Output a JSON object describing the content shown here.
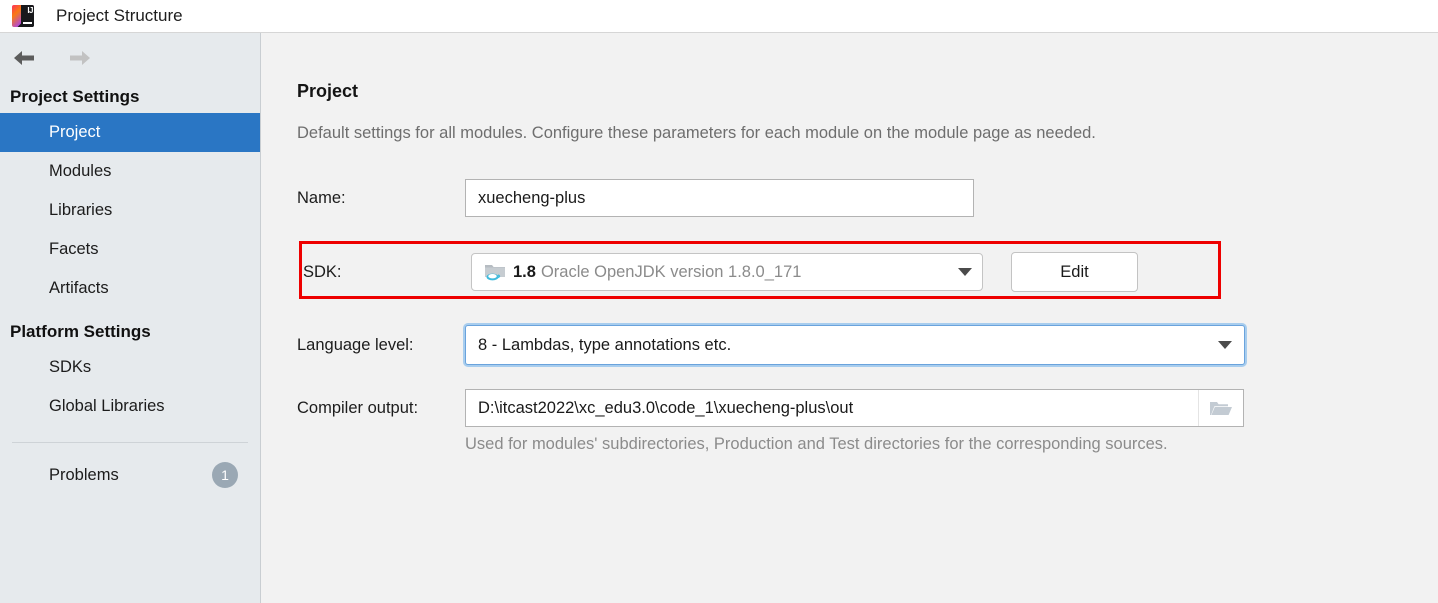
{
  "window": {
    "title": "Project Structure",
    "logo_icon": "intellij-idea-logo"
  },
  "navigation": {
    "back_icon": "arrow-left-icon",
    "forward_icon": "arrow-right-icon"
  },
  "sidebar": {
    "groups": [
      {
        "header": "Project Settings",
        "items": [
          {
            "label": "Project",
            "selected": true
          },
          {
            "label": "Modules",
            "selected": false
          },
          {
            "label": "Libraries",
            "selected": false
          },
          {
            "label": "Facets",
            "selected": false
          },
          {
            "label": "Artifacts",
            "selected": false
          }
        ]
      },
      {
        "header": "Platform Settings",
        "items": [
          {
            "label": "SDKs",
            "selected": false
          },
          {
            "label": "Global Libraries",
            "selected": false
          }
        ]
      }
    ],
    "problems": {
      "label": "Problems",
      "count": "1"
    },
    "selected_bg": "#2a76c4",
    "background": "#e6eaed"
  },
  "main": {
    "title": "Project",
    "subtitle": "Default settings for all modules. Configure these parameters for each module on the module page as needed.",
    "name": {
      "label": "Name:",
      "value": "xuecheng-plus"
    },
    "sdk": {
      "label": "SDK:",
      "icon": "jdk-folder-icon",
      "version": "1.8",
      "description": "Oracle OpenJDK version 1.8.0_171",
      "dropdown_icon": "chevron-down-icon",
      "edit_label": "Edit",
      "highlight_color": "#ee0000"
    },
    "language_level": {
      "label": "Language level:",
      "value": "8 - Lambdas, type annotations etc.",
      "dropdown_icon": "chevron-down-icon"
    },
    "compiler_output": {
      "label": "Compiler output:",
      "value": "D:\\itcast2022\\xc_edu3.0\\code_1\\xuecheng-plus\\out",
      "browse_icon": "folder-open-icon",
      "hint": "Used for modules' subdirectories, Production and Test directories for the corresponding sources."
    }
  }
}
